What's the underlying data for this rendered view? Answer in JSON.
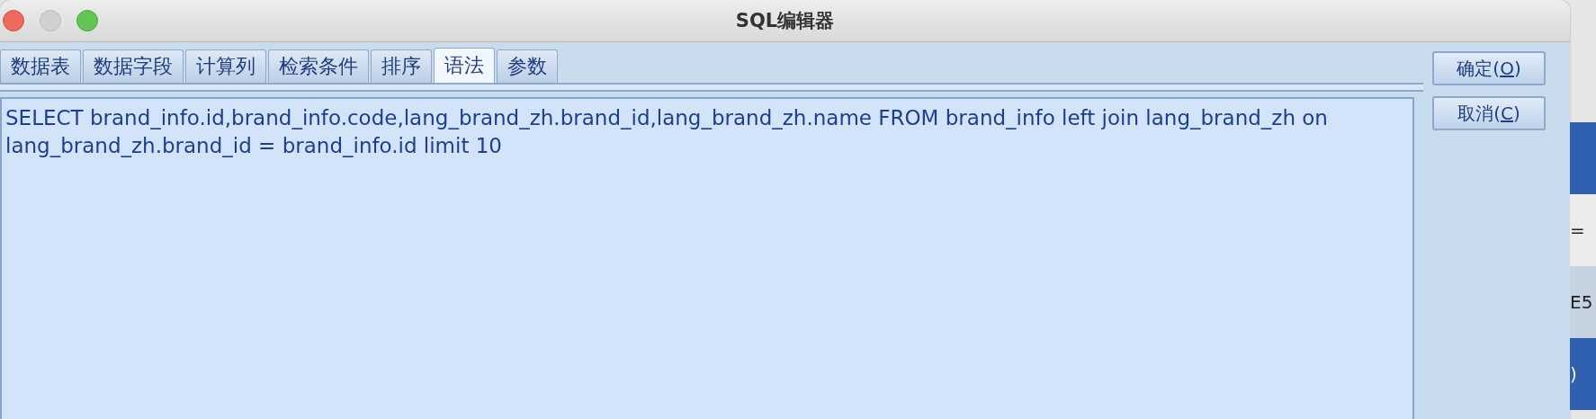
{
  "window": {
    "title": "SQL编辑器"
  },
  "tabs": [
    {
      "label": "数据表",
      "selected": false
    },
    {
      "label": "数据字段",
      "selected": false
    },
    {
      "label": "计算列",
      "selected": false
    },
    {
      "label": "检索条件",
      "selected": false
    },
    {
      "label": "排序",
      "selected": false
    },
    {
      "label": "语法",
      "selected": true
    },
    {
      "label": "参数",
      "selected": false
    }
  ],
  "sql_editor": {
    "value": "SELECT brand_info.id,brand_info.code,lang_brand_zh.brand_id,lang_brand_zh.name FROM brand_info left join lang_brand_zh on lang_brand_zh.brand_id = brand_info.id limit 10"
  },
  "buttons": [
    {
      "label_before": "确定(",
      "mnemonic": "O",
      "label_after": ")"
    },
    {
      "label_before": "取消(",
      "mnemonic": "C",
      "label_after": ")"
    }
  ],
  "background_window": {
    "rows": [
      {
        "kind": "header"
      },
      {
        "kind": "plain",
        "text": "="
      },
      {
        "kind": "alt",
        "text": "E5"
      },
      {
        "kind": "header",
        "text": ")"
      }
    ]
  }
}
